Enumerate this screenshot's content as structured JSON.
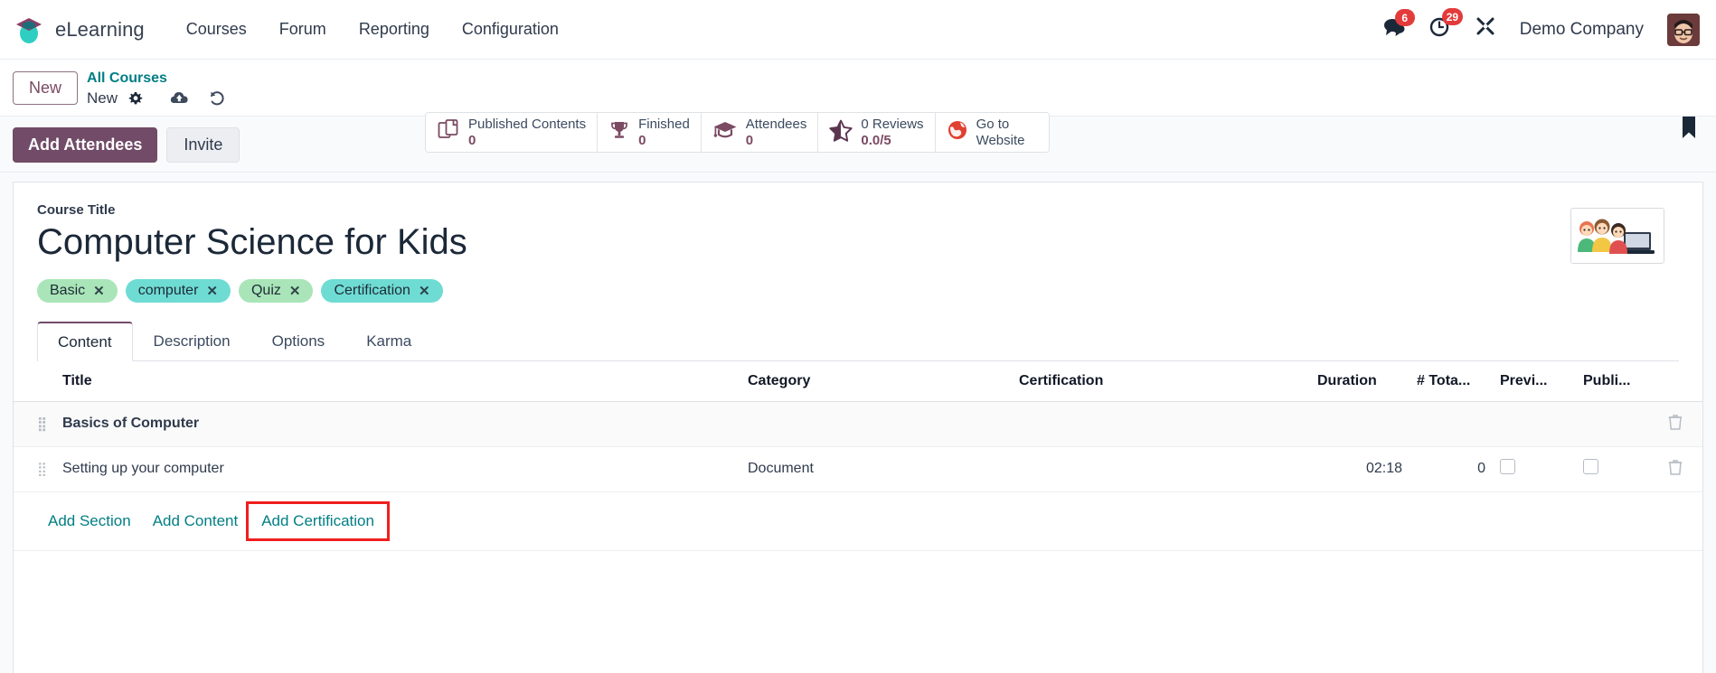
{
  "navbar": {
    "brand": "eLearning",
    "brand_logo_icon": "graduation-cap-logo",
    "links": [
      {
        "label": "Courses"
      },
      {
        "label": "Forum"
      },
      {
        "label": "Reporting"
      },
      {
        "label": "Configuration"
      }
    ],
    "messages_icon": "messages-icon",
    "messages_count": "6",
    "activities_icon": "clock-activity-icon",
    "activities_count": "29",
    "debug_icon": "developer-tools-icon",
    "company": "Demo Company",
    "avatar_icon": "user-avatar"
  },
  "control_panel": {
    "new_button": "New",
    "breadcrumb_root": "All Courses",
    "breadcrumb_current": "New",
    "settings_icon": "gear-icon",
    "save_icon": "cloud-save-icon",
    "discard_icon": "undo-discard-icon",
    "ribbon_icon": "bookmark-ribbon-icon",
    "stat_buttons": [
      {
        "icon": "published-contents-icon",
        "label": "Published Contents",
        "value": "0"
      },
      {
        "icon": "trophy-icon",
        "label": "Finished",
        "value": "0"
      },
      {
        "icon": "graduation-cap-icon",
        "label": "Attendees",
        "value": "0"
      },
      {
        "icon": "star-icon",
        "label": "0 Reviews",
        "value": "0.0/5"
      },
      {
        "icon": "globe-icon",
        "label": "Go to Website",
        "value": ""
      }
    ]
  },
  "action_bar": {
    "add_attendees": "Add Attendees",
    "invite": "Invite"
  },
  "form": {
    "title_label": "Course Title",
    "title_value": "Computer Science for Kids",
    "course_image_icon": "kids-at-computer-image",
    "tags": [
      {
        "label": "Basic",
        "color": "#a9e5b8",
        "remove_icon": "remove-tag-icon"
      },
      {
        "label": "computer",
        "color": "#6fdcd4",
        "remove_icon": "remove-tag-icon"
      },
      {
        "label": "Quiz",
        "color": "#a9e5b8",
        "remove_icon": "remove-tag-icon"
      },
      {
        "label": "Certification",
        "color": "#6fdcd4",
        "remove_icon": "remove-tag-icon"
      }
    ],
    "tabs": [
      {
        "label": "Content",
        "active": true
      },
      {
        "label": "Description",
        "active": false
      },
      {
        "label": "Options",
        "active": false
      },
      {
        "label": "Karma",
        "active": false
      }
    ]
  },
  "content_table": {
    "columns": [
      "Title",
      "Category",
      "Certification",
      "Duration",
      "# Tota...",
      "Previ...",
      "Publi..."
    ],
    "rows": [
      {
        "type": "section",
        "handle_icon": "drag-handle-icon",
        "title": "Basics of Computer",
        "category": "",
        "certification": "",
        "duration": "",
        "total": "",
        "preview": "",
        "published": "",
        "trash_icon": "trash-icon"
      },
      {
        "type": "content",
        "handle_icon": "drag-handle-icon",
        "title": "Setting up your computer",
        "category": "Document",
        "certification": "",
        "duration": "02:18",
        "total": "0",
        "preview_checkbox": "unchecked",
        "published_checkbox": "unchecked",
        "trash_icon": "trash-icon"
      }
    ],
    "add_links": [
      {
        "label": "Add Section",
        "highlighted": false
      },
      {
        "label": "Add Content",
        "highlighted": false
      },
      {
        "label": "Add Certification",
        "highlighted": true
      }
    ]
  },
  "colors": {
    "brand_purple": "#714b67",
    "link_teal": "#017e84",
    "badge_red": "#e33b3b",
    "highlight_red": "#f01e1e"
  }
}
